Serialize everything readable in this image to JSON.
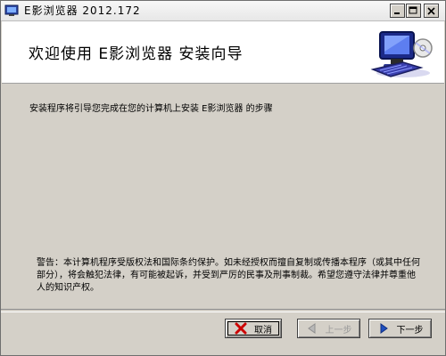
{
  "window": {
    "title": "E影浏览器 2012.172",
    "controls": [
      "minimize",
      "maximize",
      "close"
    ]
  },
  "header": {
    "title": "欢迎使用 E影浏览器 安装向导",
    "art_icon": "computer-install-icon"
  },
  "main": {
    "description": "安装程序将引导您完成在您的计算机上安装 E影浏览器 的步骤",
    "warning": "警告：本计算机程序受版权法和国际条约保护。如未经授权而擅自复制或传播本程序（或其中任何部分），将会触犯法律，有可能被起诉，并受到严厉的民事及刑事制裁。希望您遵守法律并尊重他人的知识产权。"
  },
  "buttons": {
    "cancel": {
      "label": "取消",
      "icon": "x-icon",
      "color": "#cc0000"
    },
    "back": {
      "label": "上一步",
      "icon": "back-arrow-icon",
      "enabled": false
    },
    "next": {
      "label": "下一步",
      "icon": "next-arrow-icon",
      "color": "#1f4fbf"
    }
  },
  "colors": {
    "background": "#d4d0c8",
    "header_bg": "#ffffff"
  }
}
